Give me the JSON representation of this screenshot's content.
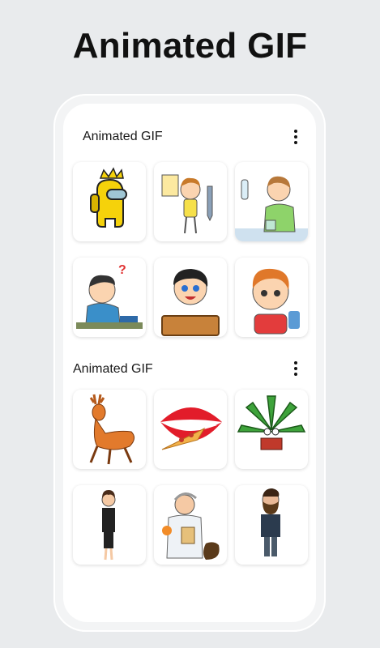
{
  "headline": "Animated GIF",
  "sections": [
    {
      "title": "Animated GIF",
      "items": [
        "among-us-crewmate",
        "boy-with-notepad",
        "boy-scientist",
        "boy-thinking-desk",
        "boy-with-sign",
        "schoolboy-backpack"
      ]
    },
    {
      "title": "Animated GIF",
      "items": [
        "deer",
        "mouth-eating-pizza",
        "cannabis-leaf-reading",
        "businesswoman",
        "doctor-with-money-bag",
        "bearded-man"
      ]
    }
  ]
}
